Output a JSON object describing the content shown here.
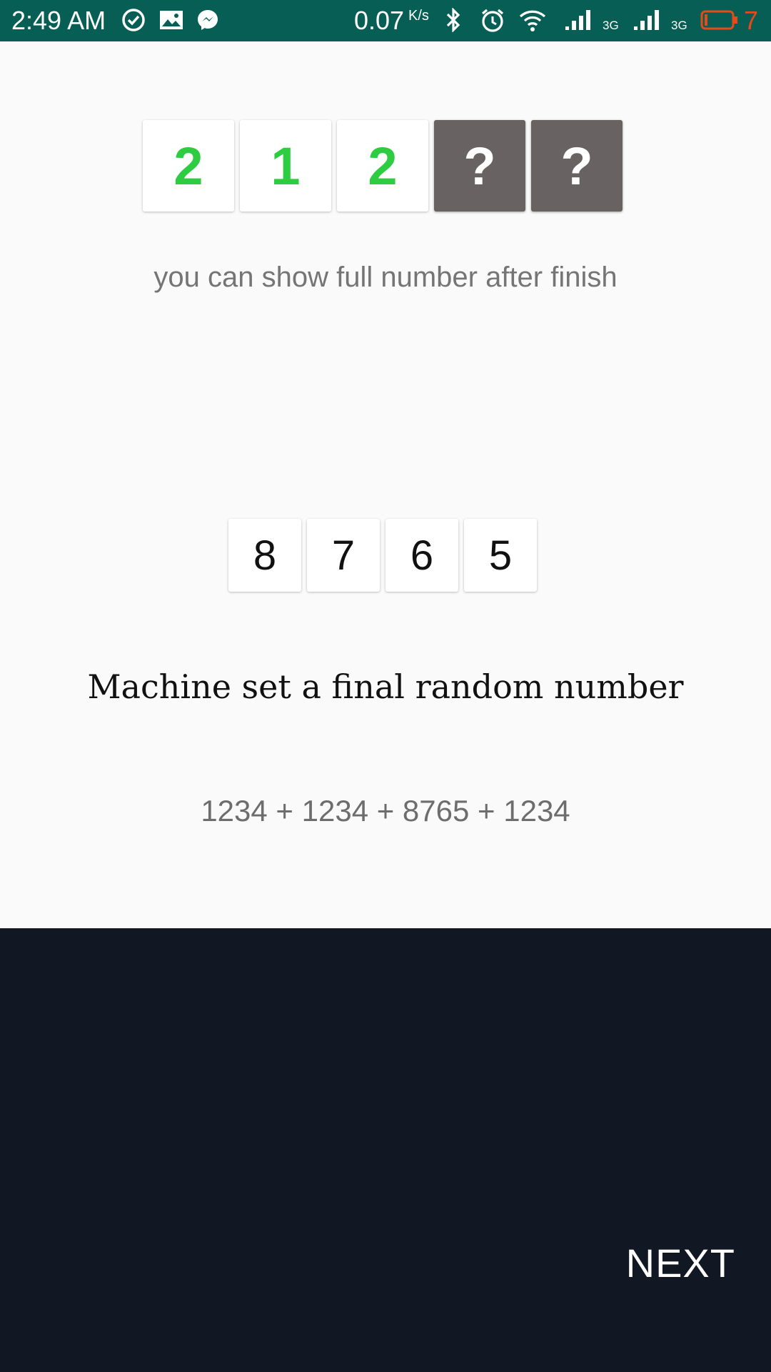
{
  "status_bar": {
    "time": "2:49 AM",
    "net_speed": "0.07",
    "net_speed_unit": "K/s",
    "network_type_1": "3G",
    "network_type_2": "3G",
    "battery_level": "7",
    "icons": [
      "check-circle-icon",
      "gallery-icon",
      "messenger-icon",
      "bluetooth-icon",
      "alarm-icon",
      "wifi-icon",
      "signal-icon",
      "signal-icon",
      "battery-icon"
    ],
    "background_color": "#075e54"
  },
  "guess": {
    "digits": [
      "2",
      "1",
      "2",
      "?",
      "?"
    ],
    "revealed_color": "#2ecc40",
    "hidden_color": "#686262",
    "hint": "you can show full number after finish"
  },
  "machine": {
    "digits": [
      "8",
      "7",
      "6",
      "5"
    ],
    "title": "Machine set a final random number",
    "formula": "1234 + 1234 + 8765 + 1234"
  },
  "footer": {
    "next_label": "NEXT",
    "background_color": "#121724"
  }
}
